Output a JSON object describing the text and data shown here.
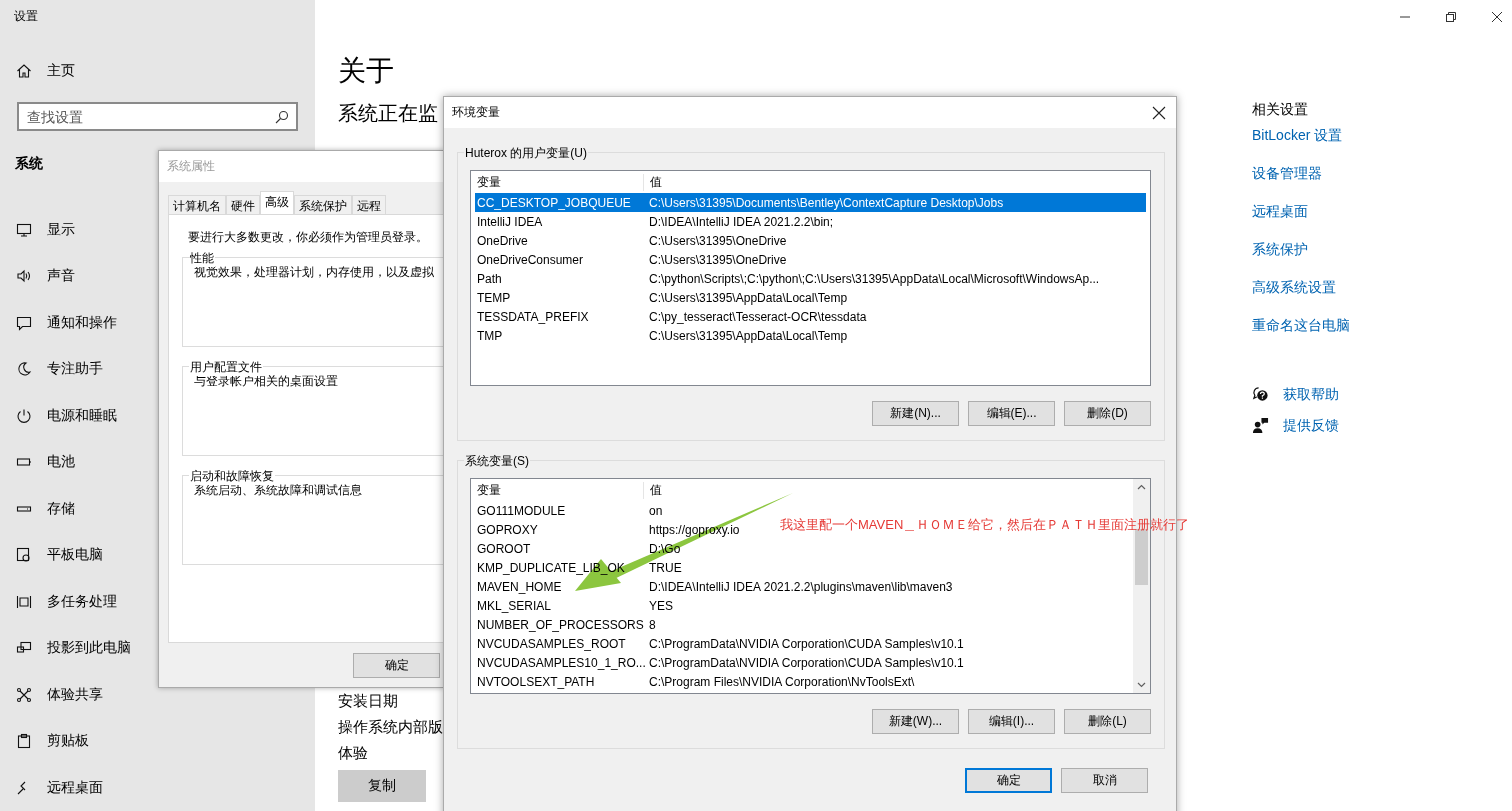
{
  "settings": {
    "title": "设置",
    "home": "主页",
    "search": {
      "placeholder": "查找设置"
    },
    "section": "系统",
    "nav": [
      {
        "label": "显示",
        "kind": "display"
      },
      {
        "label": "声音",
        "kind": "sound"
      },
      {
        "label": "通知和操作",
        "kind": "notification"
      },
      {
        "label": "专注助手",
        "kind": "moon"
      },
      {
        "label": "电源和睡眠",
        "kind": "power"
      },
      {
        "label": "电池",
        "kind": "battery"
      },
      {
        "label": "存储",
        "kind": "storage"
      },
      {
        "label": "平板电脑",
        "kind": "tablet"
      },
      {
        "label": "多任务处理",
        "kind": "multitask"
      },
      {
        "label": "投影到此电脑",
        "kind": "project"
      },
      {
        "label": "体验共享",
        "kind": "share"
      },
      {
        "label": "剪贴板",
        "kind": "clipboard"
      },
      {
        "label": "远程桌面",
        "kind": "remote"
      }
    ],
    "main": {
      "heading": "关于",
      "subheading": "系统正在监",
      "lines": [
        "安装日期",
        "操作系统内部版",
        "体验"
      ],
      "copy_button": "复制"
    },
    "related": {
      "title": "相关设置",
      "links": [
        "BitLocker 设置",
        "设备管理器",
        "远程桌面",
        "系统保护",
        "高级系统设置",
        "重命名这台电脑"
      ],
      "help": [
        {
          "label": "获取帮助",
          "kind": "help"
        },
        {
          "label": "提供反馈",
          "kind": "feedback"
        }
      ]
    }
  },
  "system_properties": {
    "title": "系统属性",
    "tabs": [
      {
        "label": "计算机名",
        "selected": false
      },
      {
        "label": "硬件",
        "selected": false
      },
      {
        "label": "高级",
        "selected": true
      },
      {
        "label": "系统保护",
        "selected": false
      },
      {
        "label": "远程",
        "selected": false
      }
    ],
    "note": "要进行大多数更改，你必须作为管理员登录。",
    "groups": [
      {
        "title": "性能",
        "text": "视觉效果，处理器计划，内存使用，以及虚拟"
      },
      {
        "title": "用户配置文件",
        "text": "与登录帐户相关的桌面设置"
      },
      {
        "title": "启动和故障恢复",
        "text": "系统启动、系统故障和调试信息"
      }
    ],
    "ok_button": "确定"
  },
  "environment_variables": {
    "title": "环境变量",
    "user_vars": {
      "title": "Huterox 的用户变量(U)",
      "columns": [
        "变量",
        "值"
      ],
      "rows": [
        {
          "name": "CC_DESKTOP_JOBQUEUE",
          "value": "C:\\Users\\31395\\Documents\\Bentley\\ContextCapture Desktop\\Jobs",
          "selected": true
        },
        {
          "name": "IntelliJ IDEA",
          "value": "D:\\IDEA\\IntelliJ IDEA 2021.2.2\\bin;",
          "selected": false
        },
        {
          "name": "OneDrive",
          "value": "C:\\Users\\31395\\OneDrive",
          "selected": false
        },
        {
          "name": "OneDriveConsumer",
          "value": "C:\\Users\\31395\\OneDrive",
          "selected": false
        },
        {
          "name": "Path",
          "value": "C:\\python\\Scripts\\;C:\\python\\;C:\\Users\\31395\\AppData\\Local\\Microsoft\\WindowsAp...",
          "selected": false
        },
        {
          "name": "TEMP",
          "value": "C:\\Users\\31395\\AppData\\Local\\Temp",
          "selected": false
        },
        {
          "name": "TESSDATA_PREFIX",
          "value": "C:\\py_tesseract\\Tesseract-OCR\\tessdata",
          "selected": false
        },
        {
          "name": "TMP",
          "value": "C:\\Users\\31395\\AppData\\Local\\Temp",
          "selected": false
        }
      ],
      "buttons": [
        "新建(N)...",
        "编辑(E)...",
        "删除(D)"
      ]
    },
    "system_vars": {
      "title": "系统变量(S)",
      "columns": [
        "变量",
        "值"
      ],
      "rows": [
        {
          "name": "GO111MODULE",
          "value": "on",
          "selected": false
        },
        {
          "name": "GOPROXY",
          "value": "https://goproxy.io",
          "selected": false
        },
        {
          "name": "GOROOT",
          "value": "D:\\Go",
          "selected": false
        },
        {
          "name": "KMP_DUPLICATE_LIB_OK",
          "value": "TRUE",
          "selected": false
        },
        {
          "name": "MAVEN_HOME",
          "value": "D:\\IDEA\\IntelliJ IDEA 2021.2.2\\plugins\\maven\\lib\\maven3",
          "selected": false
        },
        {
          "name": "MKL_SERIAL",
          "value": "YES",
          "selected": false
        },
        {
          "name": "NUMBER_OF_PROCESSORS",
          "value": "8",
          "selected": false
        },
        {
          "name": "NVCUDASAMPLES_ROOT",
          "value": "C:\\ProgramData\\NVIDIA Corporation\\CUDA Samples\\v10.1",
          "selected": false
        },
        {
          "name": "NVCUDASAMPLES10_1_RO...",
          "value": "C:\\ProgramData\\NVIDIA Corporation\\CUDA Samples\\v10.1",
          "selected": false
        },
        {
          "name": "NVTOOLSEXT_PATH",
          "value": "C:\\Program Files\\NVIDIA Corporation\\NvToolsExt\\",
          "selected": false
        }
      ],
      "buttons": [
        "新建(W)...",
        "编辑(I)...",
        "删除(L)"
      ]
    },
    "buttons": [
      "确定",
      "取消"
    ]
  },
  "annotation": {
    "text": "我这里配一个MAVEN＿ＨＯＭＥ给它，然后在ＰＡＴＨ里面注册就行了"
  }
}
